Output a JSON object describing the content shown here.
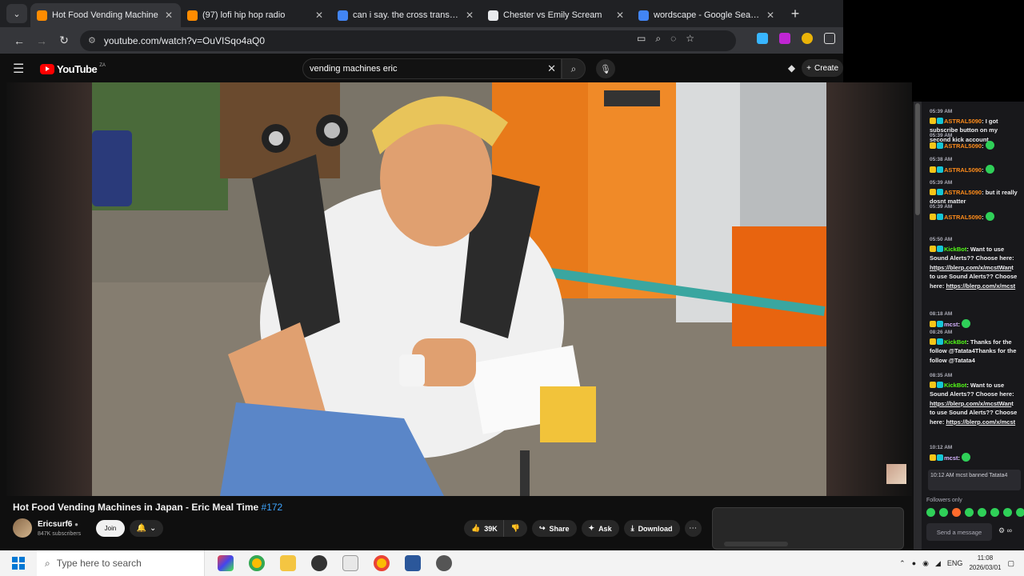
{
  "browser": {
    "tabs": [
      {
        "title": "Hot Food Vending Machine",
        "favicon_color": "#ff8c00",
        "active": true
      },
      {
        "title": "(97) lofi hip hop radio",
        "favicon_color": "#ff8c00",
        "active": false
      },
      {
        "title": "can i say. the cross transference",
        "favicon_color": "#4285f4",
        "active": false
      },
      {
        "title": "Chester vs Emily Scream",
        "favicon_color": "#e8eaed",
        "active": false
      },
      {
        "title": "wordscape - Google Search",
        "favicon_color": "#4285f4",
        "active": false
      }
    ],
    "url": "youtube.com/watch?v=OuVISqo4aQ0"
  },
  "youtube": {
    "logo_text": "YouTube",
    "region": "ZA",
    "search_value": "vending machines eric",
    "create_label": "Create"
  },
  "video": {
    "title": "Hot Food Vending Machines in Japan - Eric Meal Time",
    "episode": "#172",
    "channel": "Ericsurf6",
    "subscribers": "847K subscribers",
    "join_label": "Join",
    "likes": "39K",
    "share_label": "Share",
    "ask_label": "Ask",
    "download_label": "Download"
  },
  "chat": {
    "messages": [
      {
        "time": "05:39 AM",
        "user": "ASTRAL5090",
        "text": ": I got subscribe button on my second kick account"
      },
      {
        "time": "05:39 AM",
        "user": "ASTRAL5090",
        "text": ":"
      },
      {
        "time": "05:38 AM",
        "user": "ASTRAL5090",
        "text": ":"
      },
      {
        "time": "05:39 AM",
        "user": "ASTRAL5090",
        "text": ": but it really dosnt matter"
      },
      {
        "time": "05:39 AM",
        "user": "ASTRAL5090",
        "text": ":"
      },
      {
        "time": "05:50 AM",
        "user": "KickBot",
        "text": ": Want to use Sound Alerts?? Choose here:",
        "link": "https://blerp.com/x/mcstWan",
        "text2": "t to use Sound Alerts?? Choose here:",
        "link2": "https://blerp.com/x/mcst"
      },
      {
        "time": "08:18 AM",
        "user": "mcst",
        "text": ":"
      },
      {
        "time": "08:26 AM",
        "user": "KickBot",
        "text": ": Thanks for the follow @Tatata4Thanks for the follow @Tatata4"
      },
      {
        "time": "08:35 AM",
        "user": "KickBot",
        "text": ": Want to use Sound Alerts?? Choose here:",
        "link": "https://blerp.com/x/mcstWan",
        "text2": "t to use Sound Alerts?? Choose here:",
        "link2": "https://blerp.com/x/mcst"
      },
      {
        "time": "10:12 AM",
        "user": "mcst",
        "text": ":"
      }
    ],
    "banned_notice": "10:12 AM mcst banned Tatata4",
    "followers_only": "Followers only",
    "send_placeholder": "Send a message"
  },
  "taskbar": {
    "search_placeholder": "Type here to search",
    "language": "ENG",
    "time": "11:08",
    "date": "2026/03/01"
  }
}
